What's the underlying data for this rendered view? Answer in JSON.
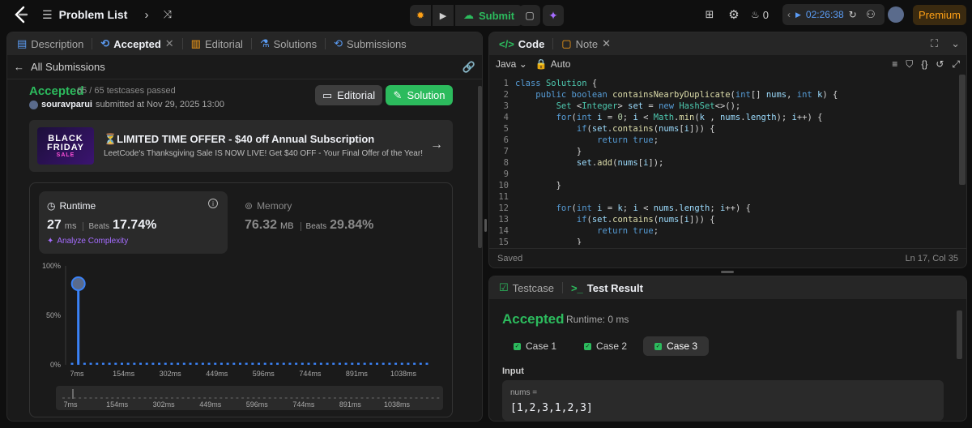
{
  "topbar": {
    "problem_list": "Problem List",
    "submit_label": "Submit",
    "streak_count": "0",
    "timer": "02:26:38",
    "premium": "Premium"
  },
  "left_tabs": [
    {
      "label": "Description"
    },
    {
      "label": "Accepted"
    },
    {
      "label": "Editorial"
    },
    {
      "label": "Solutions"
    },
    {
      "label": "Submissions"
    }
  ],
  "subnav": {
    "back_label": "All Submissions"
  },
  "submission": {
    "status": "Accepted",
    "testcases": "65 / 65 testcases passed",
    "user": "souravparui",
    "submitted_text": "submitted at Nov 29, 2025 13:00",
    "editorial_btn": "Editorial",
    "solution_btn": "Solution"
  },
  "banner": {
    "title": "⏳LIMITED TIME OFFER - $40 off Annual Subscription",
    "subtitle": "LeetCode's Thanksgiving Sale IS NOW LIVE! Get $40 OFF - Your Final Offer of the Year!",
    "art_line1": "BLACK",
    "art_line2": "FRIDAY",
    "art_line3": "SALE"
  },
  "runtime": {
    "label": "Runtime",
    "value": "27",
    "unit": "ms",
    "beats_label": "Beats",
    "beats": "17.74%",
    "analyze": "Analyze Complexity"
  },
  "memory": {
    "label": "Memory",
    "value": "76.32",
    "unit": "MB",
    "beats_label": "Beats",
    "beats": "29.84%"
  },
  "chart_data": {
    "type": "bar",
    "ylabel_ticks": [
      "0%",
      "50%",
      "100%"
    ],
    "xticks": [
      "7ms",
      "154ms",
      "302ms",
      "449ms",
      "596ms",
      "744ms",
      "891ms",
      "1038ms"
    ],
    "peak_value": 82,
    "ylim": [
      0,
      100
    ],
    "bar_count": 58,
    "baseline_value": 2
  },
  "code": {
    "tab_code": "Code",
    "tab_note": "Note",
    "language": "Java",
    "auto": "Auto",
    "status_left": "Saved",
    "status_right": "Ln 17, Col 35",
    "lines": [
      {
        "n": "1"
      },
      {
        "n": "2"
      },
      {
        "n": "3"
      },
      {
        "n": "4"
      },
      {
        "n": "5"
      },
      {
        "n": "6"
      },
      {
        "n": "7"
      },
      {
        "n": "8"
      },
      {
        "n": "9"
      },
      {
        "n": "10"
      },
      {
        "n": "11"
      },
      {
        "n": "12"
      },
      {
        "n": "13"
      },
      {
        "n": "14"
      },
      {
        "n": "15"
      }
    ]
  },
  "test": {
    "tab_testcase": "Testcase",
    "tab_result": "Test Result",
    "status": "Accepted",
    "runtime": "Runtime: 0 ms",
    "cases": [
      {
        "label": "Case 1"
      },
      {
        "label": "Case 2"
      },
      {
        "label": "Case 3"
      }
    ],
    "input_label": "Input",
    "input_name": "nums =",
    "input_value": "[1,2,3,1,2,3]"
  }
}
